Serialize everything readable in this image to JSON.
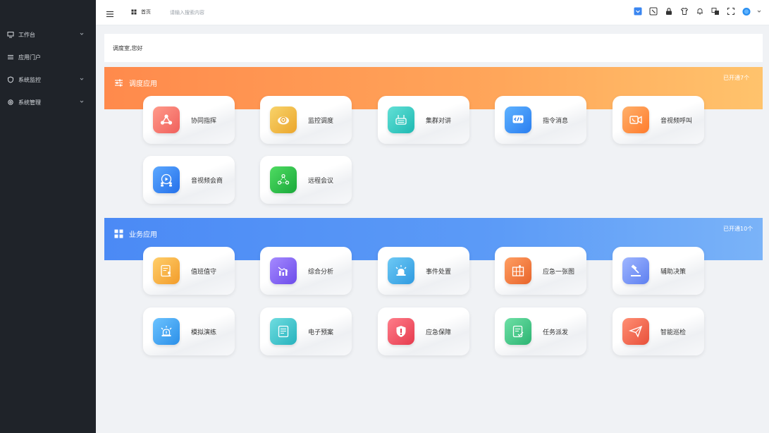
{
  "sidebar": {
    "items": [
      {
        "label": "工作台",
        "icon": "monitor-icon",
        "expandable": true
      },
      {
        "label": "应用门户",
        "icon": "list-icon",
        "expandable": false
      },
      {
        "label": "系统监控",
        "icon": "shield-icon",
        "expandable": true
      },
      {
        "label": "系统管理",
        "icon": "gear-icon",
        "expandable": true
      }
    ]
  },
  "header": {
    "home_label": "首页",
    "search_placeholder": "请输入搜索内容",
    "icons": [
      "dropdown-square-icon",
      "screenshot-icon",
      "lock-icon",
      "shirt-icon",
      "bell-icon",
      "translate-icon",
      "fullscreen-icon",
      "avatar",
      "chevron-down-icon"
    ]
  },
  "welcome": {
    "text": "调度室,您好"
  },
  "dispatch": {
    "title": "调度应用",
    "count": "已开通7个",
    "apps": [
      {
        "label": "协同指挥",
        "color": "#f26f6a"
      },
      {
        "label": "监控调度",
        "color": "#f0b43b"
      },
      {
        "label": "集群对讲",
        "color": "#2dc7c0"
      },
      {
        "label": "指令消息",
        "color": "#2e8ef0"
      },
      {
        "label": "音视频呼叫",
        "color": "#ff8c3a"
      },
      {
        "label": "音视频会商",
        "color": "#2e7ff0"
      },
      {
        "label": "远程会议",
        "color": "#2cc24a"
      }
    ]
  },
  "business": {
    "title": "业务应用",
    "count": "已开通10个",
    "apps": [
      {
        "label": "值班值守",
        "color": "#f5a83a"
      },
      {
        "label": "综合分析",
        "color": "#7b5ff0"
      },
      {
        "label": "事件处置",
        "color": "#3aa8e8"
      },
      {
        "label": "应急一张图",
        "color": "#ef7b3c"
      },
      {
        "label": "辅助决策",
        "color": "#6f8ef5"
      },
      {
        "label": "模拟演练",
        "color": "#3aa5ec"
      },
      {
        "label": "电子预案",
        "color": "#35bcc9"
      },
      {
        "label": "应急保障",
        "color": "#ef4f5e"
      },
      {
        "label": "任务派发",
        "color": "#3fc08a"
      },
      {
        "label": "智能巡检",
        "color": "#f0634a"
      }
    ]
  }
}
